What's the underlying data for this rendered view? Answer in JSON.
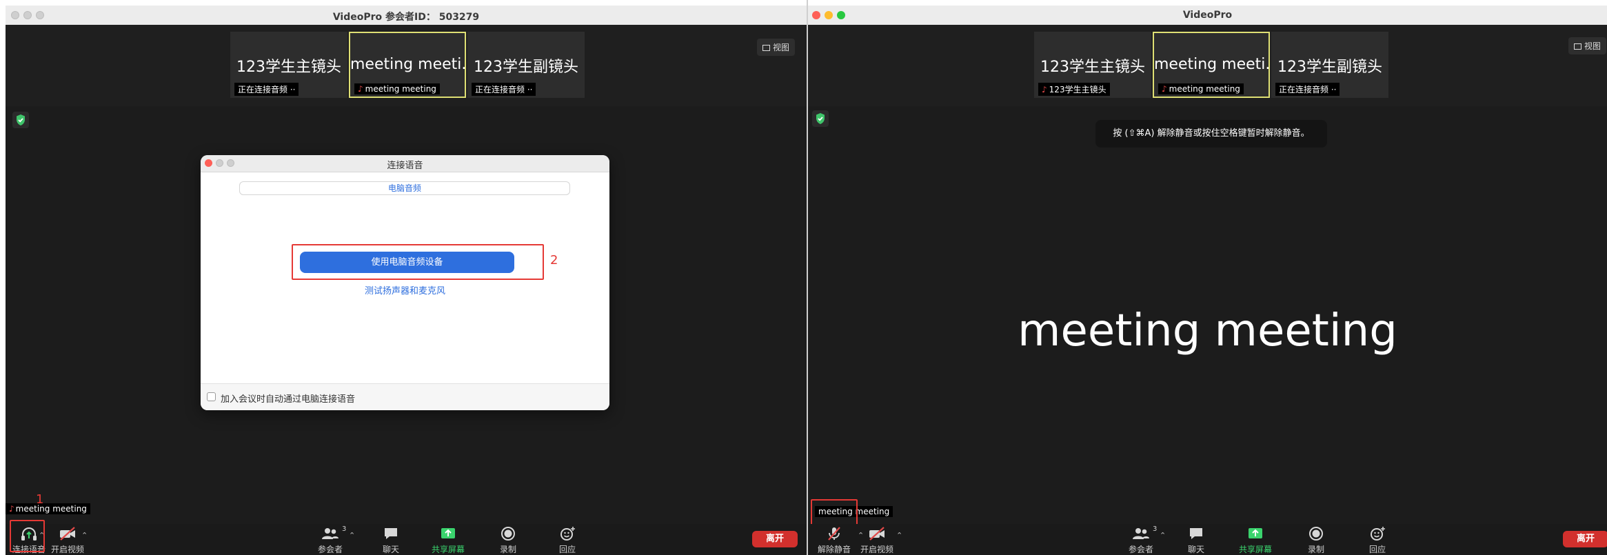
{
  "left": {
    "title": "VideoPro 参会者ID： 503279",
    "tiles": [
      {
        "name": "123学生主镜头",
        "label": "正在连接音频 ··"
      },
      {
        "name": "meeting meeti...",
        "label": "meeting meeting"
      },
      {
        "name": "123学生副镜头",
        "label": "正在连接音频 ··"
      }
    ],
    "view_label": "视图",
    "dialog": {
      "title": "连接语音",
      "tab": "电脑音频",
      "primary_button": "使用电脑音频设备",
      "test_link": "测试扬声器和麦克风",
      "auto_join_label": "加入会议时自动通过电脑连接语音",
      "step_label": "2"
    },
    "step_label": "1",
    "name_tag": "meeting meeting",
    "toolbar": {
      "audio": "连接语音",
      "video": "开启视频",
      "participants": "参会者",
      "participants_count": "3",
      "chat": "聊天",
      "share": "共享屏幕",
      "record": "录制",
      "reactions": "回应",
      "leave": "离开"
    }
  },
  "right": {
    "title": "VideoPro",
    "tiles": [
      {
        "name": "123学生主镜头",
        "label": "123学生主镜头"
      },
      {
        "name": "meeting meeti...",
        "label": "meeting meeting"
      },
      {
        "name": "123学生副镜头",
        "label": "正在连接音频 ··"
      }
    ],
    "view_label": "视图",
    "hint": "按 (⇧⌘A) 解除静音或按住空格键暂时解除静音。",
    "speaker_name": "meeting meeting",
    "name_tag": "meeting meeting",
    "toolbar": {
      "audio": "解除静音",
      "video": "开启视频",
      "participants": "参会者",
      "participants_count": "3",
      "chat": "聊天",
      "share": "共享屏幕",
      "record": "录制",
      "reactions": "回应",
      "leave": "离开"
    }
  },
  "colors": {
    "accent_blue": "#2e6fde",
    "leave_red": "#d2302d",
    "share_green": "#3ad36d",
    "annotation_red": "#e53935",
    "active_speaker_border": "#dfe074"
  }
}
